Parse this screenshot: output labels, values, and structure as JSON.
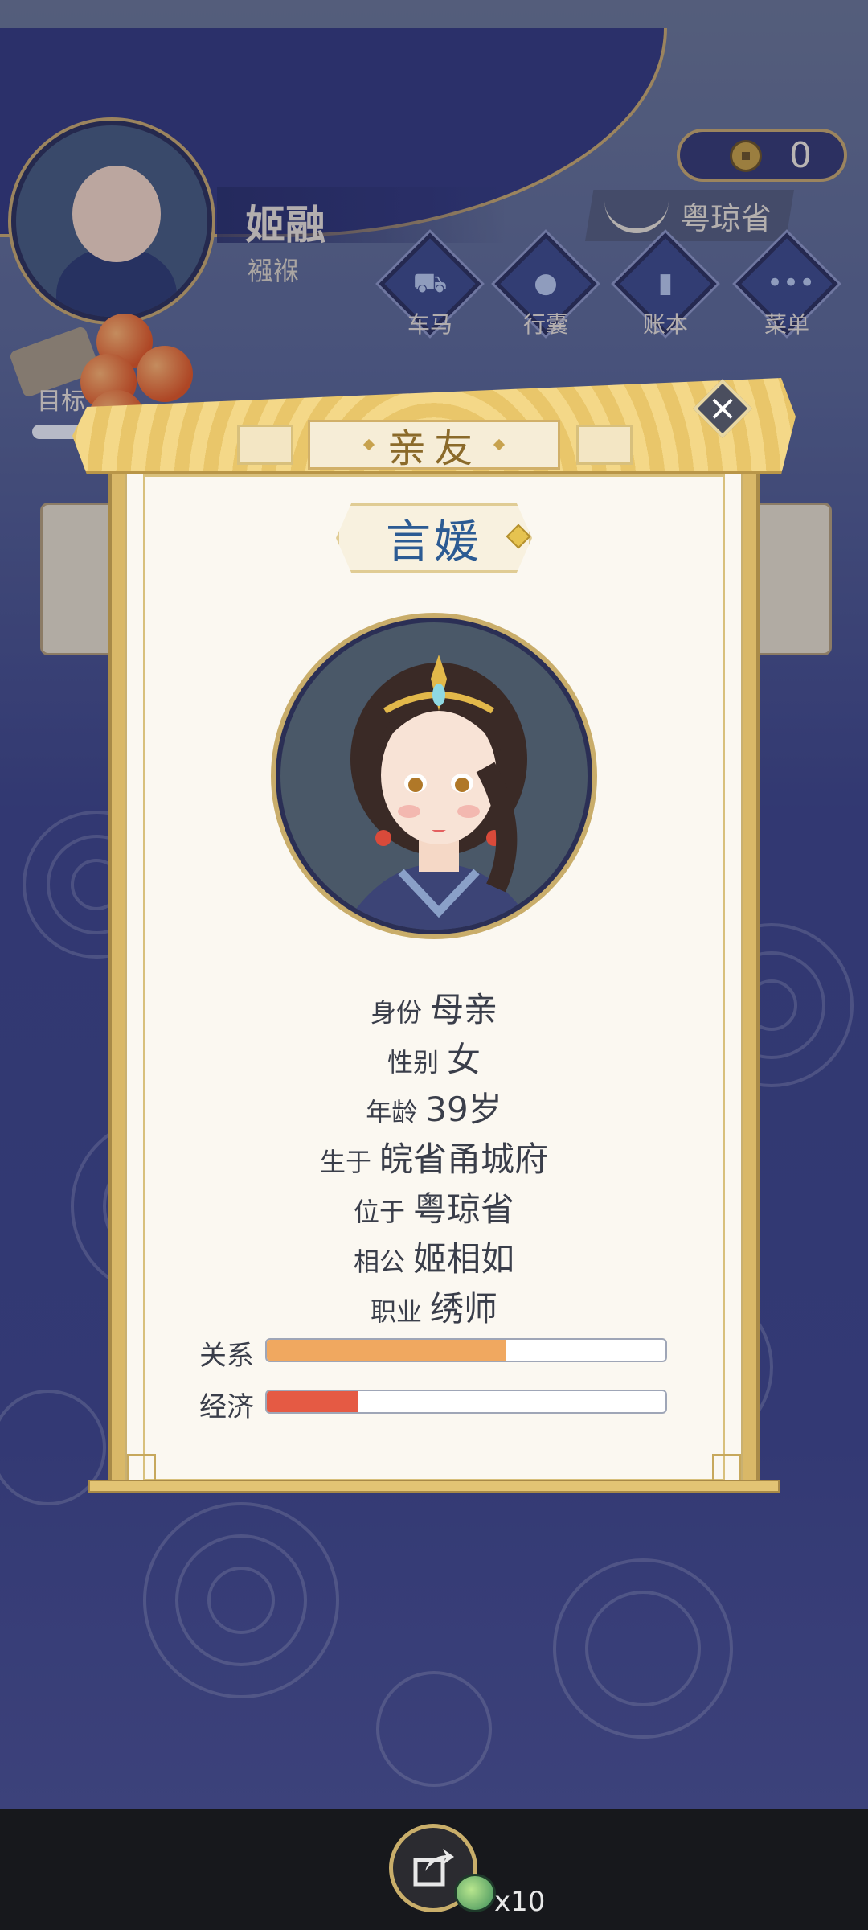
{
  "player": {
    "name": "姬融",
    "stage": "襁褓"
  },
  "currency": {
    "coins": "0",
    "icon": "coin-icon"
  },
  "location": {
    "label": "粤琼省"
  },
  "menu": {
    "items": [
      {
        "label": "车马",
        "icon": "carriage-icon"
      },
      {
        "label": "行囊",
        "icon": "bag-icon"
      },
      {
        "label": "账本",
        "icon": "ledger-icon"
      },
      {
        "label": "菜单",
        "icon": "more-icon"
      }
    ]
  },
  "goal": {
    "label": "目标"
  },
  "modal": {
    "title": "亲友",
    "character_name": "言媛",
    "fields": [
      {
        "key": "身份",
        "value": "母亲"
      },
      {
        "key": "性别",
        "value": "女"
      },
      {
        "key": "年龄",
        "value": "39岁"
      },
      {
        "key": "生于",
        "value": "皖省甬城府"
      },
      {
        "key": "位于",
        "value": "粤琼省"
      },
      {
        "key": "相公",
        "value": "姬相如"
      },
      {
        "key": "职业",
        "value": "绣师"
      }
    ],
    "stats": [
      {
        "label": "关系",
        "fraction": 0.6,
        "color": "#f0a860"
      },
      {
        "label": "经济",
        "fraction": 0.23,
        "color": "#e55a44"
      }
    ]
  },
  "bottom": {
    "multiplier": "x10"
  },
  "colors": {
    "accent_gold": "#d9b868",
    "title_blue": "#2c5b93"
  }
}
